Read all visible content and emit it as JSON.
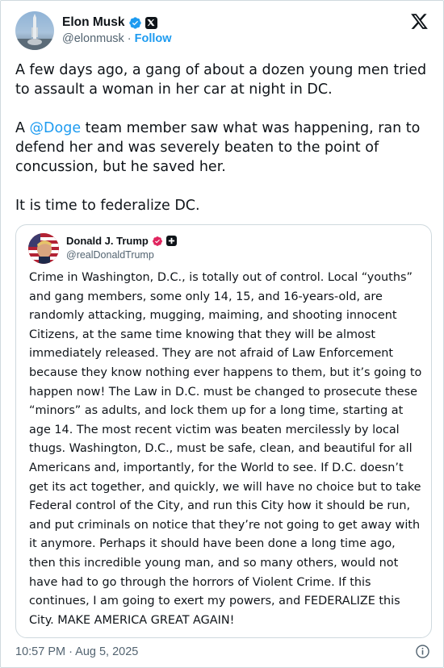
{
  "author": {
    "name": "Elon Musk",
    "handle": "@elonmusk",
    "separator": "·",
    "follow_label": "Follow"
  },
  "tweet": {
    "paragraphs": [
      {
        "text": "A few days ago, a gang of about a dozen young men tried to assault a woman in her car at night in DC."
      },
      {
        "before": "A ",
        "mention": "@Doge",
        "after": " team member saw what was happening, ran to defend her and was severely beaten to the point of concussion, but he saved her."
      },
      {
        "text": "It is time to federalize DC."
      }
    ]
  },
  "quote": {
    "name": "Donald J. Trump",
    "handle": "@realDonaldTrump",
    "text": "Crime in Washington, D.C., is totally out of control. Local “youths” and gang members, some only 14, 15, and 16-years-old, are randomly attacking, mugging, maiming, and shooting innocent Citizens, at the same time knowing that they will be almost immediately released. They are not afraid of Law Enforcement because they know nothing ever happens to them, but it’s going to happen now! The Law in D.C. must be changed to prosecute these “minors” as adults, and lock them up for a long time, starting at age 14. The most recent victim was beaten mercilessly by local thugs. Washington, D.C., must be safe, clean, and beautiful for all Americans and, importantly, for the World to see. If D.C. doesn’t get its act together, and quickly, we will have no choice but to take Federal control of the City, and run this City how it should be run, and put criminals on notice that they’re not going to get away with it anymore. Perhaps it should have been done a long time ago, then this incredible young man, and so many others, would not have had to go through the horrors of Violent Crime. If this continues, I am going to exert my powers, and FEDERALIZE this City. MAKE AMERICA GREAT AGAIN!"
  },
  "footer": {
    "timestamp": "10:57 PM · Aug 5, 2025"
  },
  "colors": {
    "accent": "#1d9bf0",
    "text": "#0f1419",
    "muted": "#536471",
    "border": "#cfd9de",
    "affiliate_badge": "#e0245e"
  },
  "icons": {
    "verified": "verified-badge-icon",
    "affiliation": "x-affiliation-icon",
    "logo": "x-logo-icon",
    "info": "info-icon"
  }
}
